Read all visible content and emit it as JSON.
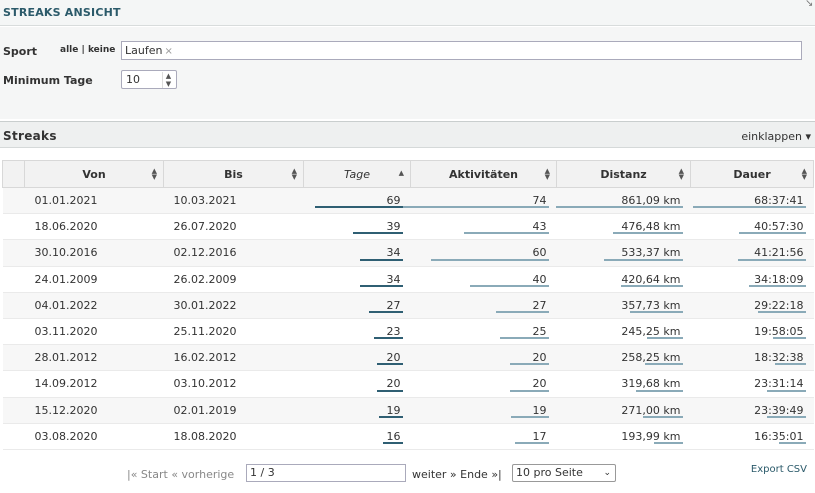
{
  "header": {
    "title": "STREAKS ANSICHT",
    "corner": "↘"
  },
  "filters": {
    "sport_label": "Sport",
    "all": "alle",
    "separator": "|",
    "none": "keine",
    "sport_tag": "Laufen",
    "tag_remove": "×",
    "min_days_label": "Minimum Tage",
    "min_days_value": "10"
  },
  "section": {
    "title": "Streaks",
    "toggle": "einklappen ▾"
  },
  "table": {
    "columns": [
      "Von",
      "Bis",
      "Tage",
      "Aktivitäten",
      "Distanz",
      "Dauer"
    ],
    "rows": [
      {
        "von": "01.01.2021",
        "bis": "10.03.2021",
        "tage": "69",
        "akt": "74",
        "dist": "861,09 km",
        "dauer": "68:37:41",
        "f_tage": 1.0,
        "f_akt": 1.0,
        "f_dist": 1.0,
        "f_dauer": 1.0
      },
      {
        "von": "18.06.2020",
        "bis": "26.07.2020",
        "tage": "39",
        "akt": "43",
        "dist": "476,48 km",
        "dauer": "40:57:30",
        "f_tage": 0.565,
        "f_akt": 0.581,
        "f_dist": 0.553,
        "f_dauer": 0.597
      },
      {
        "von": "30.10.2016",
        "bis": "02.12.2016",
        "tage": "34",
        "akt": "60",
        "dist": "533,37 km",
        "dauer": "41:21:56",
        "f_tage": 0.493,
        "f_akt": 0.811,
        "f_dist": 0.619,
        "f_dauer": 0.603
      },
      {
        "von": "24.01.2009",
        "bis": "26.02.2009",
        "tage": "34",
        "akt": "40",
        "dist": "420,64 km",
        "dauer": "34:18:09",
        "f_tage": 0.493,
        "f_akt": 0.541,
        "f_dist": 0.488,
        "f_dauer": 0.5
      },
      {
        "von": "04.01.2022",
        "bis": "30.01.2022",
        "tage": "27",
        "akt": "27",
        "dist": "357,73 km",
        "dauer": "29:22:18",
        "f_tage": 0.391,
        "f_akt": 0.365,
        "f_dist": 0.415,
        "f_dauer": 0.428
      },
      {
        "von": "03.11.2020",
        "bis": "25.11.2020",
        "tage": "23",
        "akt": "25",
        "dist": "245,25 km",
        "dauer": "19:58:05",
        "f_tage": 0.333,
        "f_akt": 0.338,
        "f_dist": 0.285,
        "f_dauer": 0.291
      },
      {
        "von": "28.01.2012",
        "bis": "16.02.2012",
        "tage": "20",
        "akt": "20",
        "dist": "258,25 km",
        "dauer": "18:32:38",
        "f_tage": 0.29,
        "f_akt": 0.27,
        "f_dist": 0.3,
        "f_dauer": 0.27
      },
      {
        "von": "14.09.2012",
        "bis": "03.10.2012",
        "tage": "20",
        "akt": "20",
        "dist": "319,68 km",
        "dauer": "23:31:14",
        "f_tage": 0.29,
        "f_akt": 0.27,
        "f_dist": 0.371,
        "f_dauer": 0.343
      },
      {
        "von": "15.12.2020",
        "bis": "02.01.2019",
        "tage": "19",
        "akt": "19",
        "dist": "271,00 km",
        "dauer": "23:39:49",
        "f_tage": 0.275,
        "f_akt": 0.257,
        "f_dist": 0.315,
        "f_dauer": 0.345
      },
      {
        "von": "03.08.2020",
        "bis": "18.08.2020",
        "tage": "16",
        "akt": "17",
        "dist": "193,99 km",
        "dauer": "16:35:01",
        "f_tage": 0.232,
        "f_akt": 0.23,
        "f_dist": 0.225,
        "f_dauer": 0.242
      }
    ]
  },
  "pager": {
    "start": "|« Start",
    "prev": "« vorherige",
    "page": "1 / 3",
    "next": "weiter »",
    "end": "Ende »|",
    "per_page": "10 pro Seite",
    "export": "Export CSV"
  },
  "colors": {
    "bar_primary": "#2f5f73",
    "bar_secondary": "#8aaab8"
  }
}
